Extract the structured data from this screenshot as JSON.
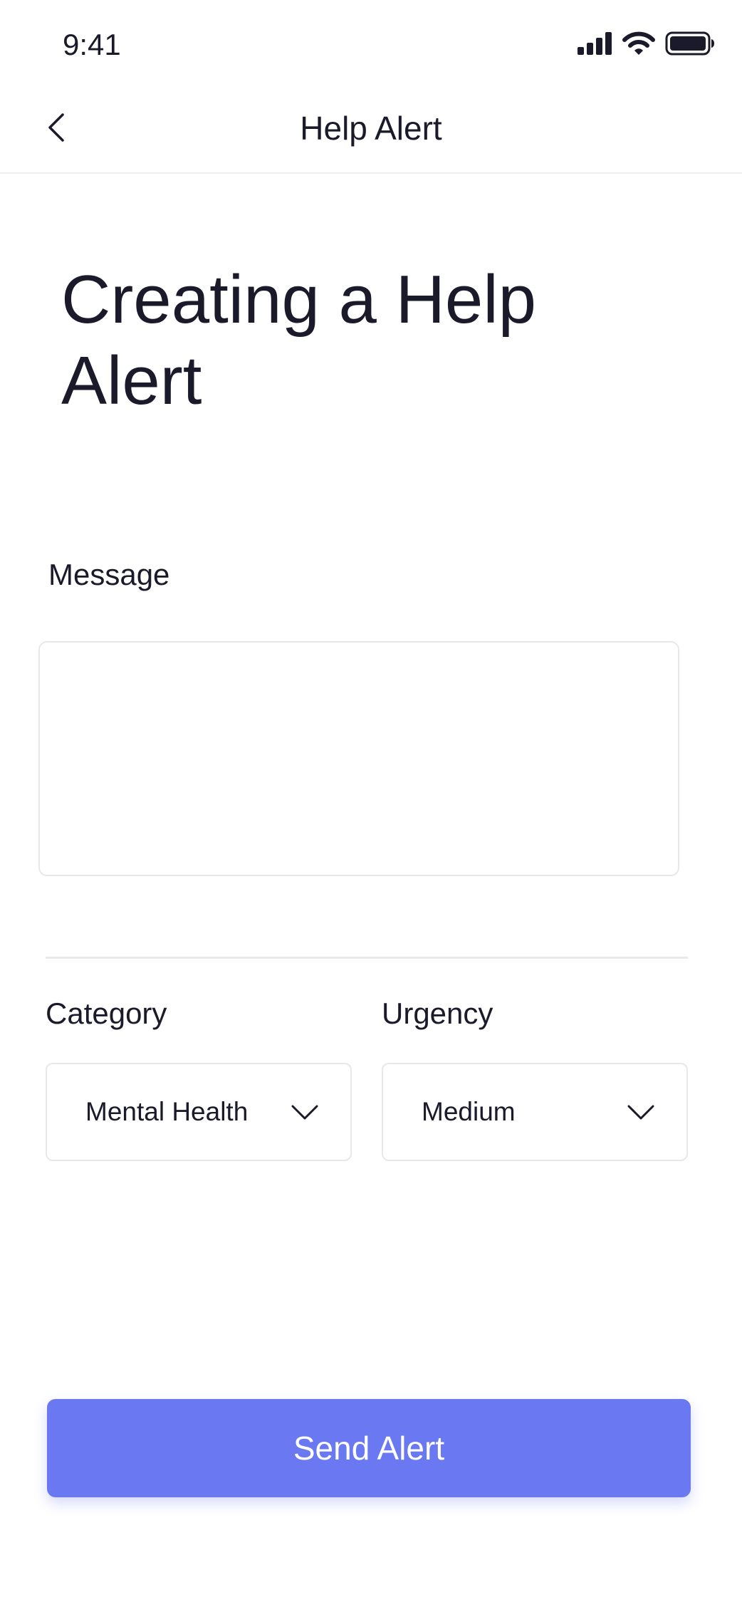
{
  "status_bar": {
    "time": "9:41",
    "icons": [
      "cellular-signal-icon",
      "wifi-icon",
      "battery-icon"
    ]
  },
  "nav": {
    "back_icon": "chevron-left-icon",
    "title": "Help Alert"
  },
  "page": {
    "heading": "Creating a Help Alert"
  },
  "form": {
    "message": {
      "label": "Message",
      "value": "",
      "placeholder": ""
    },
    "category": {
      "label": "Category",
      "selected": "Mental Health",
      "icon": "chevron-down-icon"
    },
    "urgency": {
      "label": "Urgency",
      "selected": "Medium",
      "icon": "chevron-down-icon"
    },
    "submit_label": "Send Alert"
  },
  "colors": {
    "accent": "#6a78f2",
    "text": "#1a1a2a",
    "border": "#e8e8ec"
  }
}
